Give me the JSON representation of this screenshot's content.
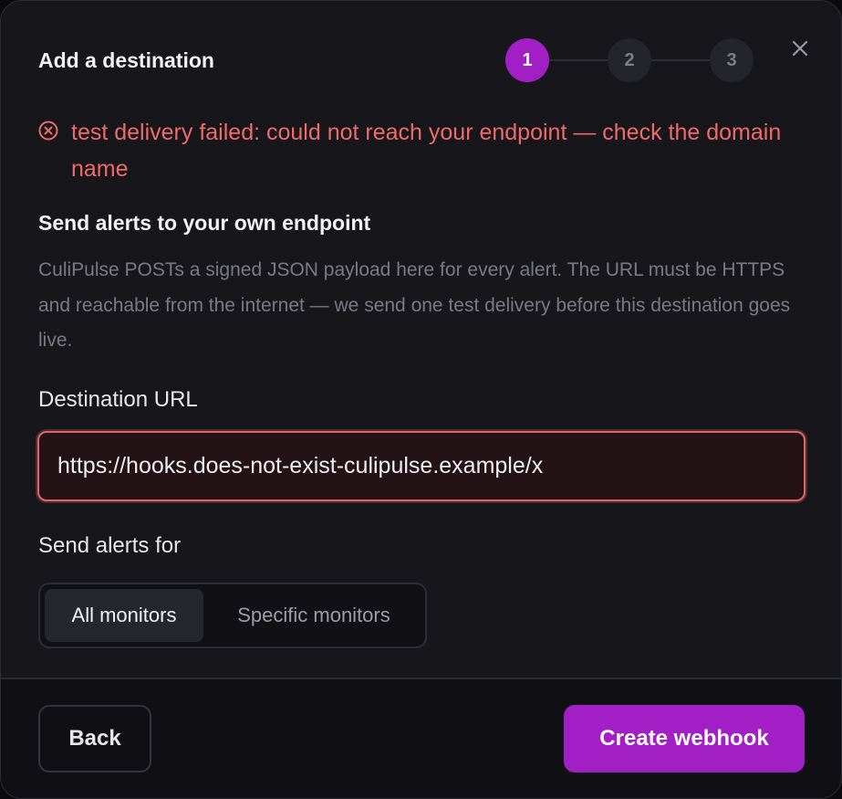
{
  "dialog": {
    "title": "Add a destination",
    "close_icon": "close-icon",
    "steps": [
      {
        "label": "1",
        "state": "active"
      },
      {
        "label": "2",
        "state": "inactive"
      },
      {
        "label": "3",
        "state": "inactive"
      }
    ]
  },
  "error": {
    "icon": "error-circle-icon",
    "message": "test delivery failed: could not reach your endpoint — check the domain name"
  },
  "section": {
    "title": "Send alerts to your own endpoint",
    "description": "CuliPulse POSTs a signed JSON payload here for every alert. The URL must be HTTPS and reachable from the internet — we send one test delivery before this destination goes live."
  },
  "url_field": {
    "label": "Destination URL",
    "value": "https://hooks.does-not-exist-culipulse.example/x"
  },
  "alerts_for": {
    "label": "Send alerts for",
    "options": [
      "All monitors",
      "Specific monitors"
    ],
    "selected": "All monitors"
  },
  "footer": {
    "back_label": "Back",
    "create_label": "Create webhook"
  },
  "colors": {
    "accent": "#a21fc6",
    "error": "#f06a6a",
    "background": "#16161b"
  }
}
